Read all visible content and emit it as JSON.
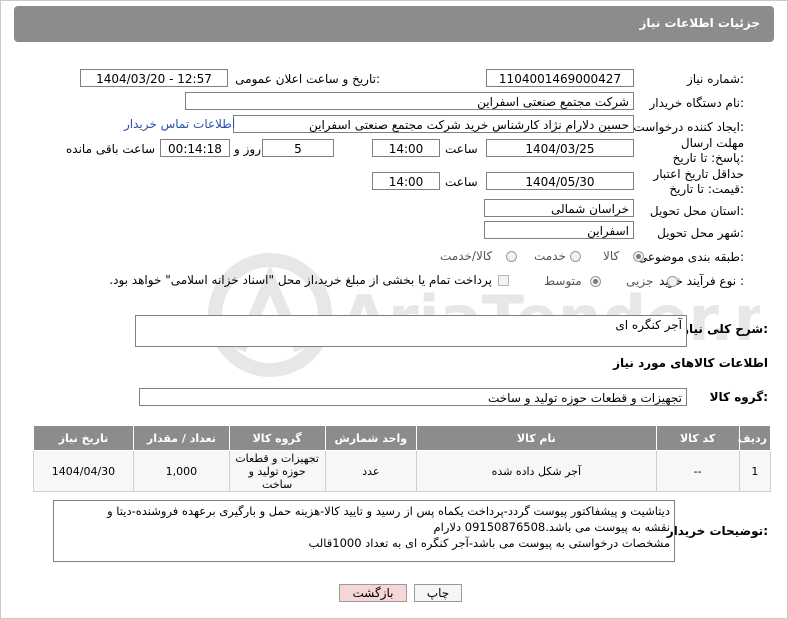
{
  "header": {
    "title": "جزئیات اطلاعات نیاز"
  },
  "form": {
    "need_number_label": "شماره نیاز:",
    "need_number": "1104001469000427",
    "announce_label": "تاریخ و ساعت اعلان عمومی:",
    "announce_value": "1404/03/20 - 12:57",
    "buyer_org_label": "نام دستگاه خریدار:",
    "buyer_org": "شرکت مجتمع صنعتی اسفراین",
    "creator_label": "ایجاد کننده درخواست:",
    "creator": "حسین دلارام نژاد کارشناس خرید شرکت مجتمع صنعتی اسفراین",
    "contact_link": "اطلاعات تماس خریدار",
    "deadline_label": "مهلت ارسال پاسخ: تا تاریخ:",
    "deadline_date": "1404/03/25",
    "time_word": "ساعت",
    "deadline_time": "14:00",
    "days_value": "5",
    "days_word": "روز و",
    "remaining_time": "00:14:18",
    "remaining_word": "ساعت باقی مانده",
    "validity_label": "حداقل تاریخ اعتبار قیمت: تا تاریخ:",
    "validity_date": "1404/05/30",
    "validity_time": "14:00",
    "province_label": "استان محل تحویل:",
    "province": "خراسان شمالی",
    "city_label": "شهر محل تحویل:",
    "city": "اسفراین",
    "category_label": "طبقه بندی موضوعی:",
    "category_options": [
      "کالا",
      "خدمت",
      "کالا/خدمت"
    ],
    "process_label": "نوع فرآیند خرید :",
    "process_options": [
      "جزیی",
      "متوسط"
    ],
    "payment_note": "پرداخت تمام یا بخشی از مبلغ خرید،از محل \"اسناد خزانه اسلامی\" خواهد بود."
  },
  "summary": {
    "label": "شرح کلی نیاز:",
    "value": "آجر کنگره ای"
  },
  "goods_section_title": "اطلاعات کالاهای مورد نیاز",
  "goods_group": {
    "label": "گروه کالا:",
    "value": "تجهیزات و قطعات حوزه تولید و ساخت"
  },
  "table": {
    "headers": [
      "ردیف",
      "کد کالا",
      "نام کالا",
      "واحد شمارش",
      "گروه کالا",
      "تعداد / مقدار",
      "تاریخ نیاز"
    ],
    "rows": [
      [
        "1",
        "--",
        "آجر شکل داده شده",
        "عدد",
        "تجهیزات و قطعات حوزه تولید و ساخت",
        "1,000",
        "1404/04/30"
      ]
    ]
  },
  "buyer_notes": {
    "label": "توضیحات خریدار:",
    "lines": [
      "دیتاشیت و پیشفاکتور پیوست گردد-پرداخت یکماه پس از رسید و تایید کالا-هزینه حمل و بارگیری برعهده فروشنده-دیتا و",
      "نقشه به پیوست می باشد.09150876508 دلارام",
      "مشخصات درخواستی به پیوست می باشد-آجر کنگره ای به تعداد 1000قالب"
    ]
  },
  "buttons": {
    "print": "چاپ",
    "back": "بازگشت"
  },
  "watermark": {
    "text": "AriaTender.net"
  },
  "colors": {
    "header_bg": "#8c8c8c",
    "link": "#2a51a6",
    "back_btn": "#f7d6d6"
  }
}
